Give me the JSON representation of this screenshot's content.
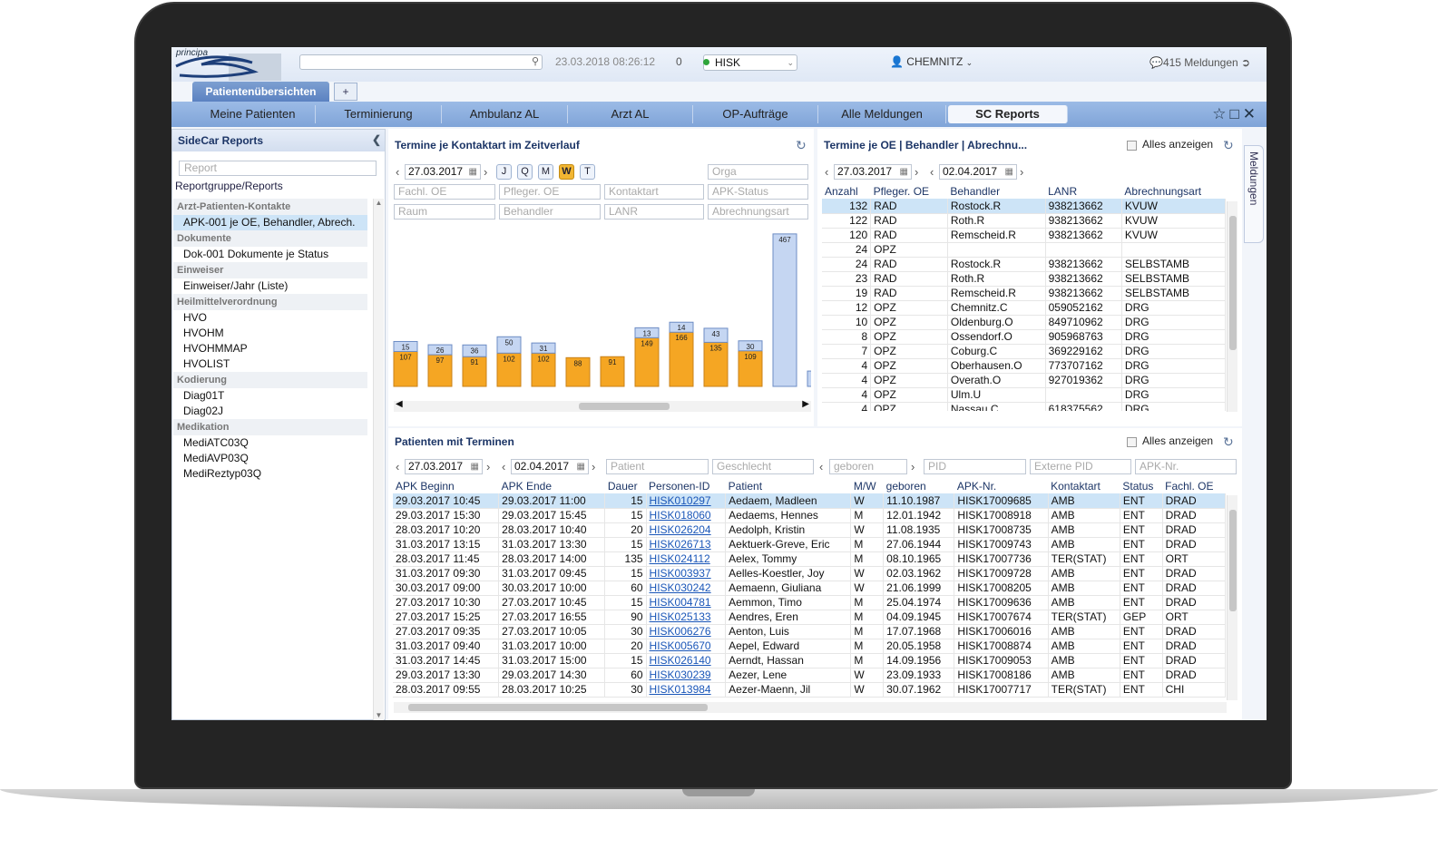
{
  "header": {
    "logo_text": "principa",
    "datetime": "23.03.2018 08:26:12",
    "count": "0",
    "site": "HISK",
    "user": "CHEMNITZ",
    "messages": "415 Meldungen"
  },
  "tabs": {
    "patient_tab": "Patientenübersichten",
    "add": "+"
  },
  "nav": [
    "Meine Patienten",
    "Terminierung",
    "Ambulanz AL",
    "Arzt AL",
    "OP-Aufträge",
    "Alle Meldungen",
    "SC Reports"
  ],
  "sidebar": {
    "title": "SideCar Reports",
    "search_placeholder": "Report",
    "link": "Reportgruppe/Reports",
    "groups": [
      {
        "name": "Arzt-Patienten-Kontakte",
        "items": [
          "APK-001 je OE, Behandler, Abrech."
        ]
      },
      {
        "name": "Dokumente",
        "items": [
          "Dok-001 Dokumente je Status"
        ]
      },
      {
        "name": "Einweiser",
        "items": [
          "Einweiser/Jahr (Liste)"
        ]
      },
      {
        "name": "Heilmittelverordnung",
        "items": [
          "HVO",
          "HVOHM",
          "HVOHMMAP",
          "HVOLIST"
        ]
      },
      {
        "name": "Kodierung",
        "items": [
          "Diag01T",
          "Diag02J"
        ]
      },
      {
        "name": "Medikation",
        "items": [
          "MediATC03Q",
          "MediAVP03Q",
          "MediReztyp03Q"
        ]
      }
    ]
  },
  "chart_panel": {
    "title": "Termine je Kontaktart im Zeitverlauf",
    "date": "27.03.2017",
    "periods": [
      "J",
      "Q",
      "M",
      "W",
      "T"
    ],
    "filters": [
      "Orga",
      "Fachl. OE",
      "Pfleger. OE",
      "Kontaktart",
      "APK-Status",
      "Raum",
      "Behandler",
      "LANR",
      "Abrechnungsart"
    ]
  },
  "chart_data": {
    "type": "bar",
    "stacked": true,
    "series": [
      {
        "name": "",
        "color": "#f5a623",
        "values": [
          107,
          97,
          91,
          102,
          102,
          88,
          91,
          149,
          166,
          135,
          109,
          0,
          0
        ]
      },
      {
        "name": "",
        "color": "#c5d6f2",
        "values": [
          15,
          26,
          36,
          50,
          31,
          0,
          0,
          13,
          14,
          43,
          30,
          467,
          47
        ]
      }
    ]
  },
  "oe_panel": {
    "title": "Termine je OE | Behandler | Abrechnu...",
    "show_all": "Alles anzeigen",
    "date_from": "27.03.2017",
    "date_to": "02.04.2017",
    "columns": [
      "Anzahl",
      "Pfleger. OE",
      "Behandler",
      "LANR",
      "Abrechnungsart"
    ],
    "rows": [
      [
        "132",
        "RAD",
        "Rostock.R",
        "938213662",
        "KVUW"
      ],
      [
        "122",
        "RAD",
        "Roth.R",
        "938213662",
        "KVUW"
      ],
      [
        "120",
        "RAD",
        "Remscheid.R",
        "938213662",
        "KVUW"
      ],
      [
        "24",
        "OPZ",
        "",
        "",
        ""
      ],
      [
        "24",
        "RAD",
        "Rostock.R",
        "938213662",
        "SELBSTAMB"
      ],
      [
        "23",
        "RAD",
        "Roth.R",
        "938213662",
        "SELBSTAMB"
      ],
      [
        "19",
        "RAD",
        "Remscheid.R",
        "938213662",
        "SELBSTAMB"
      ],
      [
        "12",
        "OPZ",
        "Chemnitz.C",
        "059052162",
        "DRG"
      ],
      [
        "10",
        "OPZ",
        "Oldenburg.O",
        "849710962",
        "DRG"
      ],
      [
        "8",
        "OPZ",
        "Ossendorf.O",
        "905968763",
        "DRG"
      ],
      [
        "7",
        "OPZ",
        "Coburg.C",
        "369229162",
        "DRG"
      ],
      [
        "4",
        "OPZ",
        "Oberhausen.O",
        "773707162",
        "DRG"
      ],
      [
        "4",
        "OPZ",
        "Overath.O",
        "927019362",
        "DRG"
      ],
      [
        "4",
        "OPZ",
        "Ulm.U",
        "",
        "DRG"
      ],
      [
        "4",
        "OPZ",
        "Nassau.C",
        "618375562",
        "DRG"
      ]
    ]
  },
  "patients_panel": {
    "title": "Patienten mit Terminen",
    "show_all": "Alles anzeigen",
    "date_from": "27.03.2017",
    "date_to": "02.04.2017",
    "filters": [
      "Patient",
      "Geschlecht",
      "geboren",
      "PID",
      "Externe PID",
      "APK-Nr."
    ],
    "columns": [
      "APK Beginn",
      "APK Ende",
      "Dauer",
      "Personen-ID",
      "Patient",
      "M/W",
      "geboren",
      "APK-Nr.",
      "Kontaktart",
      "Status",
      "Fachl. OE"
    ],
    "rows": [
      [
        "29.03.2017 10:45",
        "29.03.2017 11:00",
        "15",
        "HISK010297",
        "Aedaem, Madleen",
        "W",
        "11.10.1987",
        "HISK17009685",
        "AMB",
        "ENT",
        "DRAD"
      ],
      [
        "29.03.2017 15:30",
        "29.03.2017 15:45",
        "15",
        "HISK018060",
        "Aedaems, Hennes",
        "M",
        "12.01.1942",
        "HISK17008918",
        "AMB",
        "ENT",
        "DRAD"
      ],
      [
        "28.03.2017 10:20",
        "28.03.2017 10:40",
        "20",
        "HISK026204",
        "Aedolph, Kristin",
        "W",
        "11.08.1935",
        "HISK17008735",
        "AMB",
        "ENT",
        "DRAD"
      ],
      [
        "31.03.2017 13:15",
        "31.03.2017 13:30",
        "15",
        "HISK026713",
        "Aektuerk-Greve, Eric",
        "M",
        "27.06.1944",
        "HISK17009743",
        "AMB",
        "ENT",
        "DRAD"
      ],
      [
        "28.03.2017 11:45",
        "28.03.2017 14:00",
        "135",
        "HISK024112",
        "Aelex, Tommy",
        "M",
        "08.10.1965",
        "HISK17007736",
        "TER(STAT)",
        "ENT",
        "ORT"
      ],
      [
        "31.03.2017 09:30",
        "31.03.2017 09:45",
        "15",
        "HISK003937",
        "Aelles-Koestler, Joy",
        "W",
        "02.03.1962",
        "HISK17009728",
        "AMB",
        "ENT",
        "DRAD"
      ],
      [
        "30.03.2017 09:00",
        "30.03.2017 10:00",
        "60",
        "HISK030242",
        "Aemaenn, Giuliana",
        "W",
        "21.06.1999",
        "HISK17008205",
        "AMB",
        "ENT",
        "DRAD"
      ],
      [
        "27.03.2017 10:30",
        "27.03.2017 10:45",
        "15",
        "HISK004781",
        "Aemmon, Timo",
        "M",
        "25.04.1974",
        "HISK17009636",
        "AMB",
        "ENT",
        "DRAD"
      ],
      [
        "27.03.2017 15:25",
        "27.03.2017 16:55",
        "90",
        "HISK025133",
        "Aendres, Eren",
        "M",
        "04.09.1945",
        "HISK17007674",
        "TER(STAT)",
        "GEP",
        "ORT"
      ],
      [
        "27.03.2017 09:35",
        "27.03.2017 10:05",
        "30",
        "HISK006276",
        "Aenton, Luis",
        "M",
        "17.07.1968",
        "HISK17006016",
        "AMB",
        "ENT",
        "DRAD"
      ],
      [
        "31.03.2017 09:40",
        "31.03.2017 10:00",
        "20",
        "HISK005670",
        "Aepel, Edward",
        "M",
        "20.05.1958",
        "HISK17008874",
        "AMB",
        "ENT",
        "DRAD"
      ],
      [
        "31.03.2017 14:45",
        "31.03.2017 15:00",
        "15",
        "HISK026140",
        "Aerndt, Hassan",
        "M",
        "14.09.1956",
        "HISK17009053",
        "AMB",
        "ENT",
        "DRAD"
      ],
      [
        "29.03.2017 13:30",
        "29.03.2017 14:30",
        "60",
        "HISK030239",
        "Aezer, Lene",
        "W",
        "23.09.1933",
        "HISK17008186",
        "AMB",
        "ENT",
        "DRAD"
      ],
      [
        "28.03.2017 09:55",
        "28.03.2017 10:25",
        "30",
        "HISK013984",
        "Aezer-Maenn, Jil",
        "W",
        "30.07.1962",
        "HISK17007717",
        "TER(STAT)",
        "ENT",
        "CHI"
      ]
    ]
  },
  "meldungen_tab": "Meldungen"
}
